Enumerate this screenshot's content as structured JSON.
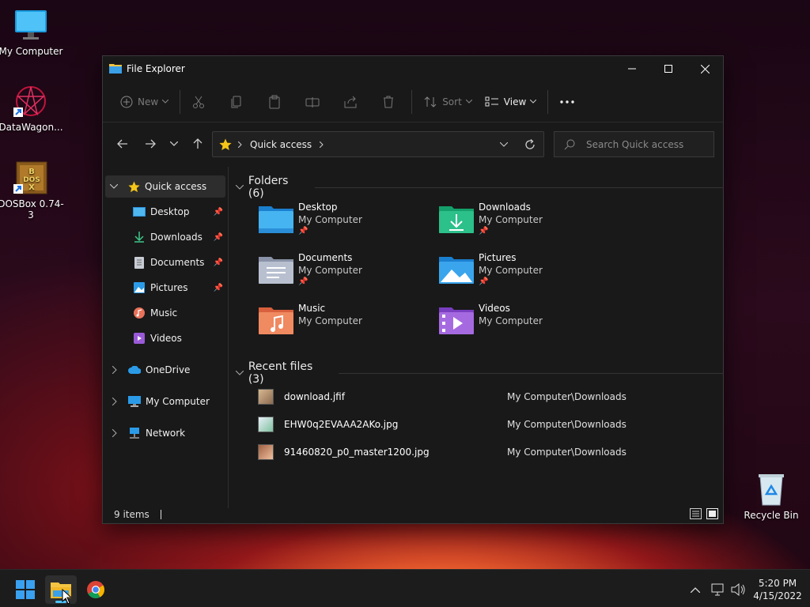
{
  "desktop": {
    "icons": [
      {
        "label": "My Computer"
      },
      {
        "label": "DataWagon..."
      },
      {
        "label": "DOSBox 0.74-3"
      },
      {
        "label": "Recycle Bin"
      }
    ]
  },
  "window": {
    "title": "File Explorer",
    "toolbar": {
      "new": "New",
      "sort": "Sort",
      "view": "View",
      "more": "..."
    },
    "address": {
      "location": "Quick access"
    },
    "search": {
      "placeholder": "Search Quick access"
    },
    "sidebar": {
      "quick_access": "Quick access",
      "pinned": [
        "Desktop",
        "Downloads",
        "Documents",
        "Pictures"
      ],
      "others": [
        "Music",
        "Videos"
      ],
      "onedrive": "OneDrive",
      "my_computer": "My Computer",
      "network": "Network"
    },
    "folders_header": "Folders (6)",
    "folders": [
      {
        "name": "Desktop",
        "sub": "My Computer",
        "pinned": true
      },
      {
        "name": "Downloads",
        "sub": "My Computer",
        "pinned": true
      },
      {
        "name": "Documents",
        "sub": "My Computer",
        "pinned": true
      },
      {
        "name": "Pictures",
        "sub": "My Computer",
        "pinned": true
      },
      {
        "name": "Music",
        "sub": "My Computer",
        "pinned": false
      },
      {
        "name": "Videos",
        "sub": "My Computer",
        "pinned": false
      }
    ],
    "recent_header": "Recent files (3)",
    "recent": [
      {
        "name": "download.jfif",
        "location": "My Computer\\Downloads"
      },
      {
        "name": "EHW0q2EVAAA2AKo.jpg",
        "location": "My Computer\\Downloads"
      },
      {
        "name": "91460820_p0_master1200.jpg",
        "location": "My Computer\\Downloads"
      }
    ],
    "status": {
      "items": "9 items"
    }
  },
  "taskbar": {
    "time": "5:20 PM",
    "date": "4/15/2022"
  },
  "colors": {
    "accent": "#4cc2ff",
    "folder_blue": "#3aa0e8",
    "window_bg": "#191919",
    "taskbar_bg": "#1c1c1c"
  }
}
